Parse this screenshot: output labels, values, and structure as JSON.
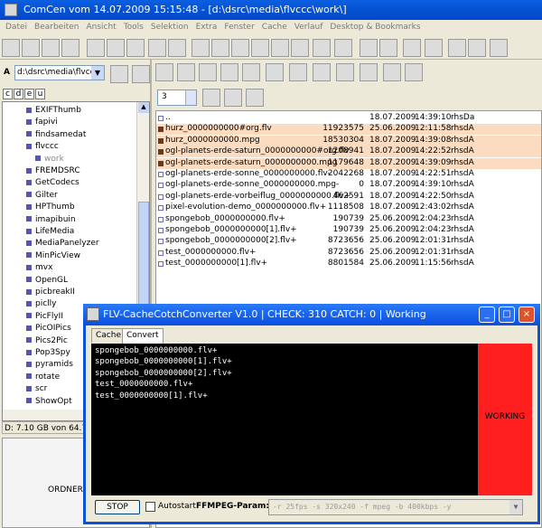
{
  "window": {
    "title": "ComCen vom 14.07.2009 15:15:48 - [d:\\dsrc\\media\\flvccc\\work\\]"
  },
  "menu": [
    "Datei",
    "Bearbeiten",
    "Ansicht",
    "Tools",
    "Selektion",
    "Extra",
    "Fenster",
    "Cache",
    "Verlauf",
    "Desktop & Bookmarks"
  ],
  "left": {
    "drive_label": "A",
    "drive_path": "d:\\dsrc\\media\\flvccc",
    "drive_letters": [
      "c",
      "d",
      "e",
      "u"
    ],
    "tree": [
      "EXIFThumb",
      "fapivi",
      "findsamedat",
      "flvccc",
      "work",
      "FREMDSRC",
      "GetCodecs",
      "Gilter",
      "HPThumb",
      "imapibuin",
      "LifeMedia",
      "MediaPanelyzer",
      "MinPicView",
      "mvx",
      "OpenGL",
      "picbreakII",
      "piclly",
      "PicFlyII",
      "PicOIPics",
      "Pics2Pic",
      "Pop3Spy",
      "pyramids",
      "rotate",
      "scr",
      "ShowOpt"
    ],
    "selected_index": 4,
    "status": "D: 7.10 GB von 64.76",
    "ordner": "ORDNER"
  },
  "right": {
    "spin_value": "3",
    "files": [
      {
        "name": "..",
        "size": "",
        "date": "18.07.2009",
        "time": "14:39:10",
        "attr": "rhsDa",
        "hl": false
      },
      {
        "name": "hurz_0000000000#org.flv",
        "size": "11923575",
        "date": "25.06.2009",
        "time": "12:11:58",
        "attr": "rhsdA",
        "hl": true
      },
      {
        "name": "hurz_0000000000.mpg",
        "size": "18530304",
        "date": "18.07.2009",
        "time": "14:39:08",
        "attr": "rhsdA",
        "hl": true
      },
      {
        "name": "ogl-planets-erde-saturn_0000000000#org.flv",
        "size": "1208941",
        "date": "18.07.2009",
        "time": "14:22:52",
        "attr": "rhsdA",
        "hl": true
      },
      {
        "name": "ogl-planets-erde-saturn_0000000000.mpg",
        "size": "1179648",
        "date": "18.07.2009",
        "time": "14:39:09",
        "attr": "rhsdA",
        "hl": true
      },
      {
        "name": "ogl-planets-erde-sonne_0000000000.flv-",
        "size": "2042268",
        "date": "18.07.2009",
        "time": "14:22:51",
        "attr": "rhsdA",
        "hl": false
      },
      {
        "name": "ogl-planets-erde-sonne_0000000000.mpg-",
        "size": "0",
        "date": "18.07.2009",
        "time": "14:39:10",
        "attr": "rhsdA",
        "hl": false
      },
      {
        "name": "ogl-planets-erde-vorbeiflug_0000000000.flv+",
        "size": "462591",
        "date": "18.07.2009",
        "time": "14:22:50",
        "attr": "rhsdA",
        "hl": false
      },
      {
        "name": "pixel-evolution-demo_0000000000.flv+",
        "size": "1118508",
        "date": "18.07.2009",
        "time": "12:43:02",
        "attr": "rhsdA",
        "hl": false
      },
      {
        "name": "spongebob_0000000000.flv+",
        "size": "190739",
        "date": "25.06.2009",
        "time": "12:04:23",
        "attr": "rhsdA",
        "hl": false
      },
      {
        "name": "spongebob_0000000000[1].flv+",
        "size": "190739",
        "date": "25.06.2009",
        "time": "12:04:23",
        "attr": "rhsdA",
        "hl": false
      },
      {
        "name": "spongebob_0000000000[2].flv+",
        "size": "8723656",
        "date": "25.06.2009",
        "time": "12:01:31",
        "attr": "rhsdA",
        "hl": false
      },
      {
        "name": "test_0000000000.flv+",
        "size": "8723656",
        "date": "25.06.2009",
        "time": "12:01:31",
        "attr": "rhsdA",
        "hl": false
      },
      {
        "name": "test_0000000000[1].flv+",
        "size": "8801584",
        "date": "25.06.2009",
        "time": "11:15:56",
        "attr": "rhsdA",
        "hl": false
      }
    ]
  },
  "dialog": {
    "title": "FLV-CacheCotchConverter V1.0 | CHECK: 310 CATCH: 0 | Working",
    "tabs": [
      "Cache",
      "Convert"
    ],
    "active_tab": 1,
    "console_lines": [
      "spongebob_0000000000.flv+",
      "spongebob_0000000000[1].flv+",
      "spongebob_0000000000[2].flv+",
      "test_0000000000.flv+",
      "test_0000000000[1].flv+"
    ],
    "status": "WORKING",
    "status_color": "#ff1f1f",
    "stop_label": "STOP",
    "autostart_label": "Autostart",
    "param_label": "FFMPEG-Param:",
    "param_value": "-r 25fps -s 320x240 -f mpeg -b 400kbps -y"
  }
}
